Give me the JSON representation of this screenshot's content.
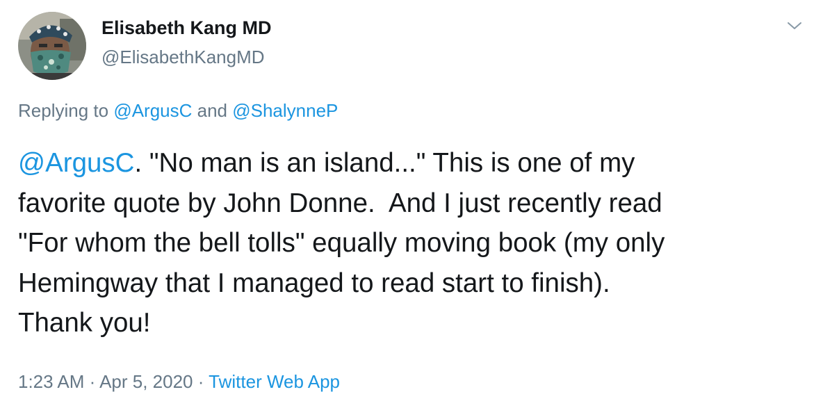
{
  "author": {
    "name": "Elisabeth Kang MD",
    "handle": "@ElisabethKangMD",
    "avatar_icon": "profile-photo"
  },
  "menu": {
    "icon": "chevron-down-icon"
  },
  "reply": {
    "prefix": "Replying to ",
    "users": [
      "@ArgusC",
      "@ShalynneP"
    ],
    "conjunction": " and "
  },
  "tweet": {
    "mention": "@ArgusC",
    "text": ". \"No man is an island...\" This is one of my\nfavorite quote by John Donne.  And I just recently read\n\"For whom the bell tolls\" equally moving book (my only\nHemingway that I managed to read start to finish).\nThank you!"
  },
  "meta": {
    "time": "1:23 AM",
    "separator1": " · ",
    "date": "Apr 5, 2020",
    "separator2": " · ",
    "source": "Twitter Web App"
  },
  "colors": {
    "text": "#14171a",
    "secondary": "#657786",
    "link": "#1b95e0"
  }
}
